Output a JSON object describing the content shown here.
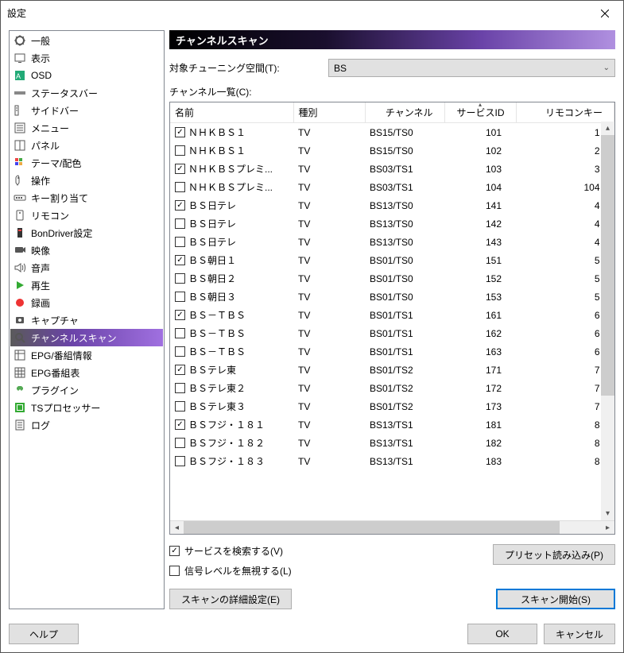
{
  "window": {
    "title": "設定"
  },
  "sidebar": {
    "items": [
      {
        "label": "一般"
      },
      {
        "label": "表示"
      },
      {
        "label": "OSD"
      },
      {
        "label": "ステータスバー"
      },
      {
        "label": "サイドバー"
      },
      {
        "label": "メニュー"
      },
      {
        "label": "パネル"
      },
      {
        "label": "テーマ/配色"
      },
      {
        "label": "操作"
      },
      {
        "label": "キー割り当て"
      },
      {
        "label": "リモコン"
      },
      {
        "label": "BonDriver設定"
      },
      {
        "label": "映像"
      },
      {
        "label": "音声"
      },
      {
        "label": "再生"
      },
      {
        "label": "録画"
      },
      {
        "label": "キャプチャ"
      },
      {
        "label": "チャンネルスキャン"
      },
      {
        "label": "EPG/番組情報"
      },
      {
        "label": "EPG番組表"
      },
      {
        "label": "プラグイン"
      },
      {
        "label": "TSプロセッサー"
      },
      {
        "label": "ログ"
      }
    ],
    "selected_index": 17
  },
  "section": {
    "title": "チャンネルスキャン"
  },
  "tuning": {
    "label": "対象チューニング空間(T):",
    "value": "BS"
  },
  "list_label": "チャンネル一覧(C):",
  "columns": {
    "name": "名前",
    "type": "種別",
    "channel": "チャンネル",
    "service_id": "サービスID",
    "remote_key": "リモコンキー"
  },
  "rows": [
    {
      "checked": true,
      "name": "ＮＨＫＢＳ１",
      "type": "TV",
      "channel": "BS15/TS0",
      "service_id": 101,
      "remote_key": "1"
    },
    {
      "checked": false,
      "name": "ＮＨＫＢＳ１",
      "type": "TV",
      "channel": "BS15/TS0",
      "service_id": 102,
      "remote_key": "2"
    },
    {
      "checked": true,
      "name": "ＮＨＫＢＳプレミ...",
      "type": "TV",
      "channel": "BS03/TS1",
      "service_id": 103,
      "remote_key": "3"
    },
    {
      "checked": false,
      "name": "ＮＨＫＢＳプレミ...",
      "type": "TV",
      "channel": "BS03/TS1",
      "service_id": 104,
      "remote_key": "104"
    },
    {
      "checked": true,
      "name": "ＢＳ日テレ",
      "type": "TV",
      "channel": "BS13/TS0",
      "service_id": 141,
      "remote_key": "4"
    },
    {
      "checked": false,
      "name": "ＢＳ日テレ",
      "type": "TV",
      "channel": "BS13/TS0",
      "service_id": 142,
      "remote_key": "4"
    },
    {
      "checked": false,
      "name": "ＢＳ日テレ",
      "type": "TV",
      "channel": "BS13/TS0",
      "service_id": 143,
      "remote_key": "4"
    },
    {
      "checked": true,
      "name": "ＢＳ朝日１",
      "type": "TV",
      "channel": "BS01/TS0",
      "service_id": 151,
      "remote_key": "5"
    },
    {
      "checked": false,
      "name": "ＢＳ朝日２",
      "type": "TV",
      "channel": "BS01/TS0",
      "service_id": 152,
      "remote_key": "5"
    },
    {
      "checked": false,
      "name": "ＢＳ朝日３",
      "type": "TV",
      "channel": "BS01/TS0",
      "service_id": 153,
      "remote_key": "5"
    },
    {
      "checked": true,
      "name": "ＢＳ－ＴＢＳ",
      "type": "TV",
      "channel": "BS01/TS1",
      "service_id": 161,
      "remote_key": "6"
    },
    {
      "checked": false,
      "name": "ＢＳ－ＴＢＳ",
      "type": "TV",
      "channel": "BS01/TS1",
      "service_id": 162,
      "remote_key": "6"
    },
    {
      "checked": false,
      "name": "ＢＳ－ＴＢＳ",
      "type": "TV",
      "channel": "BS01/TS1",
      "service_id": 163,
      "remote_key": "6"
    },
    {
      "checked": true,
      "name": "ＢＳテレ東",
      "type": "TV",
      "channel": "BS01/TS2",
      "service_id": 171,
      "remote_key": "7"
    },
    {
      "checked": false,
      "name": "ＢＳテレ東２",
      "type": "TV",
      "channel": "BS01/TS2",
      "service_id": 172,
      "remote_key": "7"
    },
    {
      "checked": false,
      "name": "ＢＳテレ東３",
      "type": "TV",
      "channel": "BS01/TS2",
      "service_id": 173,
      "remote_key": "7"
    },
    {
      "checked": true,
      "name": "ＢＳフジ・１８１",
      "type": "TV",
      "channel": "BS13/TS1",
      "service_id": 181,
      "remote_key": "8"
    },
    {
      "checked": false,
      "name": "ＢＳフジ・１８２",
      "type": "TV",
      "channel": "BS13/TS1",
      "service_id": 182,
      "remote_key": "8"
    },
    {
      "checked": false,
      "name": "ＢＳフジ・１８３",
      "type": "TV",
      "channel": "BS13/TS1",
      "service_id": 183,
      "remote_key": "8"
    }
  ],
  "options": {
    "search_services": {
      "label": "サービスを検索する(V)",
      "checked": true
    },
    "ignore_signal": {
      "label": "信号レベルを無視する(L)",
      "checked": false
    }
  },
  "buttons": {
    "preset_load": "プリセット読み込み(P)",
    "advanced": "スキャンの詳細設定(E)",
    "start_scan": "スキャン開始(S)",
    "help": "ヘルプ",
    "ok": "OK",
    "cancel": "キャンセル"
  }
}
